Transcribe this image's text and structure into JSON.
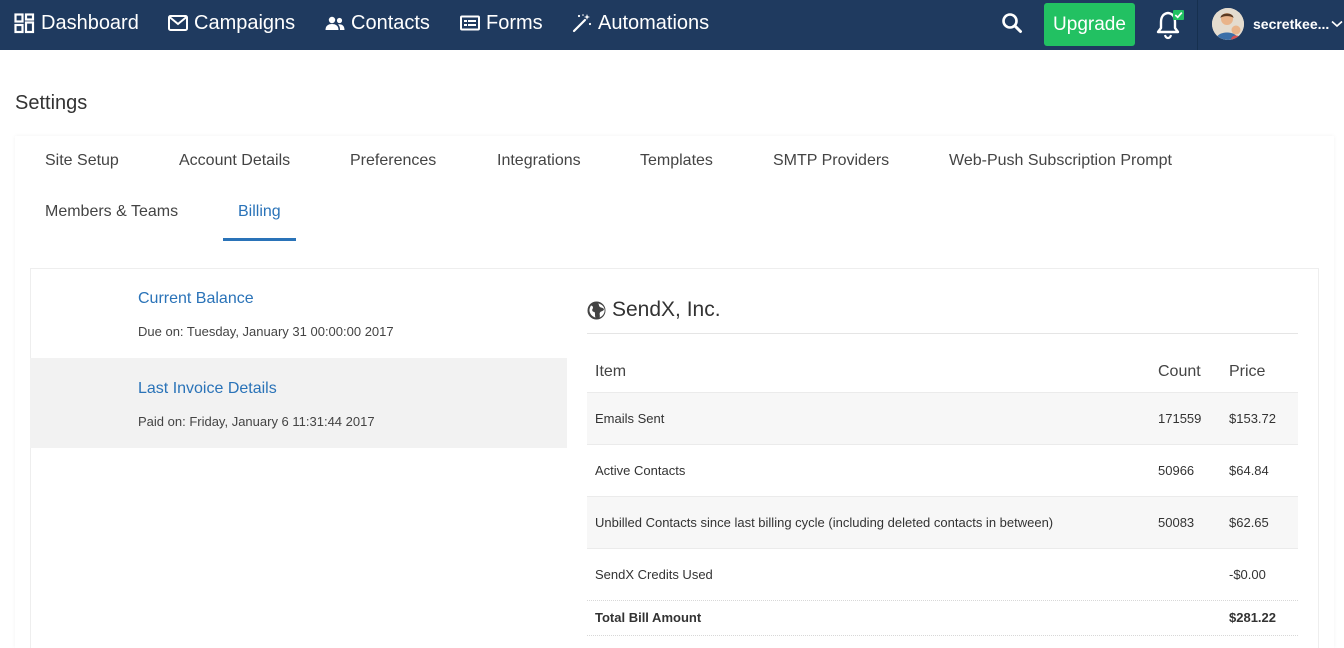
{
  "nav": {
    "items": [
      {
        "label": "Dashboard"
      },
      {
        "label": "Campaigns"
      },
      {
        "label": "Contacts"
      },
      {
        "label": "Forms"
      },
      {
        "label": "Automations"
      }
    ],
    "upgrade_label": "Upgrade",
    "username": "secretkee..."
  },
  "page": {
    "title": "Settings"
  },
  "tabs": [
    {
      "label": "Site Setup"
    },
    {
      "label": "Account Details"
    },
    {
      "label": "Preferences"
    },
    {
      "label": "Integrations"
    },
    {
      "label": "Templates"
    },
    {
      "label": "SMTP Providers"
    },
    {
      "label": "Web-Push Subscription Prompt"
    },
    {
      "label": "Members & Teams"
    },
    {
      "label": "Billing"
    }
  ],
  "billing": {
    "side": [
      {
        "title": "Current Balance",
        "subtitle": "Due on: Tuesday, January 31 00:00:00 2017"
      },
      {
        "title": "Last Invoice Details",
        "subtitle": "Paid on: Friday, January 6 11:31:44 2017"
      }
    ],
    "company": "SendX, Inc.",
    "headers": {
      "item": "Item",
      "count": "Count",
      "price": "Price"
    },
    "rows": [
      {
        "item": "Emails Sent",
        "count": "171559",
        "price": "$153.72"
      },
      {
        "item": "Active Contacts",
        "count": "50966",
        "price": "$64.84"
      },
      {
        "item": "Unbilled Contacts since last billing cycle (including deleted contacts in between)",
        "count": "50083",
        "price": "$62.65"
      },
      {
        "item": "SendX Credits Used",
        "count": "",
        "price": "-$0.00"
      }
    ],
    "total": {
      "label": "Total Bill Amount",
      "price": "$281.22"
    }
  },
  "colors": {
    "nav_bg": "#1f3a5f",
    "accent": "#2a73b8",
    "upgrade": "#22c162",
    "notify_badge": "#22c162"
  }
}
